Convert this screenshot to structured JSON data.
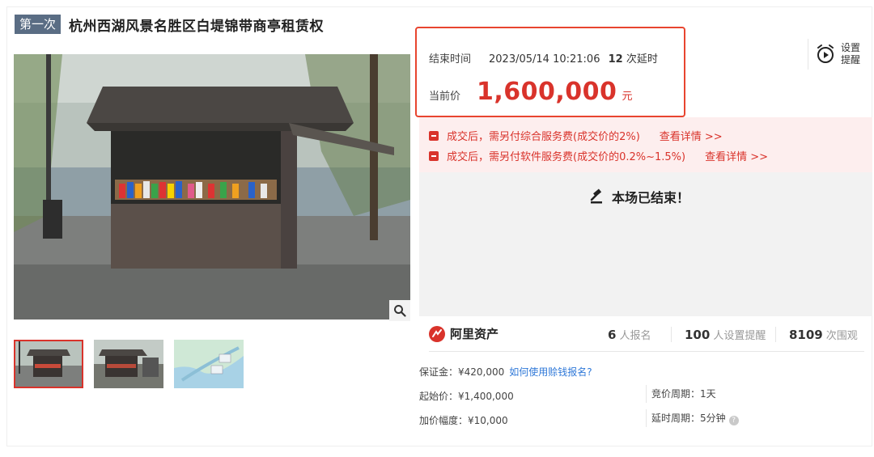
{
  "header": {
    "round_badge": "第一次",
    "title": "杭州西湖风景名胜区白堤锦带商亭租赁权"
  },
  "gallery": {
    "main_image": "kiosk-photo",
    "thumbnails": [
      "kiosk-photo",
      "kiosk-photo-side",
      "map-image"
    ],
    "selected_index": 0
  },
  "auction": {
    "end_label": "结束时间",
    "end_time": "2023/05/14 10:21:06",
    "delay_count": "12",
    "delay_suffix": "次延时",
    "price_label": "当前价",
    "price": "1,600,000",
    "price_unit": "元",
    "reminder_line1": "设置",
    "reminder_line2": "提醒"
  },
  "fees": [
    {
      "text": "成交后，需另付综合服务费(成交价的2%)",
      "link": "查看详情 >>"
    },
    {
      "text": "成交后，需另付软件服务费(成交价的0.2%~1.5%)",
      "link": "查看详情 >>"
    }
  ],
  "status": {
    "ended_text": "本场已结束！"
  },
  "stats": {
    "platform": "阿里资产",
    "signup_count": "6",
    "signup_label": "人报名",
    "remind_count": "100",
    "remind_label": "人设置提醒",
    "view_count": "8109",
    "view_label": "次围观"
  },
  "details": {
    "deposit": "保证金：¥420,000",
    "deposit_link": "如何使用赊钱报名?",
    "start_price": "起始价：¥1,400,000",
    "bid_cycle": "竞价周期：1天",
    "increment": "加价幅度：¥10,000",
    "delay_cycle": "延时周期：5分钟"
  },
  "colors": {
    "accent_red": "#d9332b",
    "badge_gray_blue": "#5a6d84",
    "link_blue": "#2f78d8",
    "fee_bg": "#fdeeee"
  }
}
